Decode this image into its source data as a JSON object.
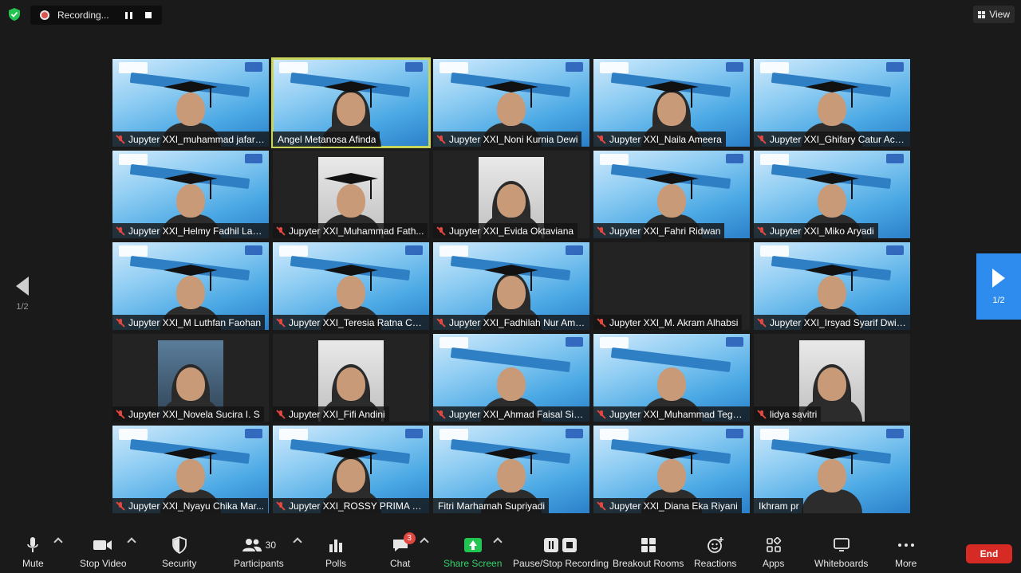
{
  "recording": {
    "label": "Recording..."
  },
  "view_label": "View",
  "pagination": {
    "left": "1/2",
    "right": "1/2"
  },
  "participants": [
    {
      "name": "Jupyter XXI_muhammad jafar ...",
      "muted": true,
      "bg": true,
      "cap": true
    },
    {
      "name": "Angel Metanosa Afinda",
      "muted": false,
      "bg": true,
      "cap": true,
      "active": true,
      "hijab": true
    },
    {
      "name": "Jupyter XXI_Noni Kurnia Dewi",
      "muted": true,
      "bg": true,
      "cap": true
    },
    {
      "name": "Jupyter XXI_Naila Ameera",
      "muted": true,
      "bg": true,
      "cap": true,
      "hijab": true
    },
    {
      "name": "Jupyter XXI_Ghifary Catur Ach...",
      "muted": true,
      "bg": true,
      "cap": true
    },
    {
      "name": "Jupyter XXI_Helmy Fadhil Lan...",
      "muted": true,
      "bg": true,
      "cap": true
    },
    {
      "name": "Jupyter XXI_Muhammad Fath...",
      "muted": true,
      "bg": false,
      "cap": true,
      "cam": "light"
    },
    {
      "name": "Jupyter XXI_Evida Oktaviana",
      "muted": true,
      "bg": false,
      "cap": false,
      "cam": "light",
      "hijab": true
    },
    {
      "name": "Jupyter XXI_Fahri Ridwan",
      "muted": true,
      "bg": true,
      "cap": true
    },
    {
      "name": "Jupyter XXI_Miko Aryadi",
      "muted": true,
      "bg": true,
      "cap": true
    },
    {
      "name": "Jupyter XXI_M Luthfan Faohan",
      "muted": true,
      "bg": true,
      "cap": true
    },
    {
      "name": "Jupyter XXI_Teresia Ratna Cali...",
      "muted": true,
      "bg": true,
      "cap": true
    },
    {
      "name": "Jupyter XXI_Fadhilah Nur Ama...",
      "muted": true,
      "bg": true,
      "cap": true,
      "hijab": true
    },
    {
      "name": "Jupyter XXI_M. Akram Alhabsi",
      "muted": true,
      "bg": false,
      "cap": false,
      "empty": true
    },
    {
      "name": "Jupyter XXI_Irsyad Syarif Dwi ...",
      "muted": true,
      "bg": true,
      "cap": true
    },
    {
      "name": "Jupyter XXI_Novela Sucira I. S",
      "muted": true,
      "bg": false,
      "cap": false,
      "cam": "dark",
      "hijab": true
    },
    {
      "name": "Jupyter XXI_Fifi Andini",
      "muted": true,
      "bg": false,
      "cap": false,
      "cam": "light",
      "hijab": true
    },
    {
      "name": "Jupyter XXI_Ahmad Faisal Sire...",
      "muted": true,
      "bg": true,
      "cap": false
    },
    {
      "name": "Jupyter XXI_Muhammad Tega...",
      "muted": true,
      "bg": true,
      "cap": false
    },
    {
      "name": "lidya savitri",
      "muted": true,
      "bg": false,
      "cap": false,
      "cam": "light",
      "hijab": true
    },
    {
      "name": "Jupyter XXI_Nyayu Chika Mar...",
      "muted": true,
      "bg": true,
      "cap": true
    },
    {
      "name": "Jupyter XXI_ROSSY PRIMA NA...",
      "muted": true,
      "bg": true,
      "cap": true,
      "hijab": true
    },
    {
      "name": "Fitri Marhamah Supriyadi",
      "muted": false,
      "bg": true,
      "cap": true
    },
    {
      "name": "Jupyter XXI_Diana Eka Riyani",
      "muted": true,
      "bg": true,
      "cap": true
    },
    {
      "name": "Ikhram pr",
      "muted": false,
      "bg": true,
      "cap": true
    }
  ],
  "toolbar": {
    "mute": "Mute",
    "stop_video": "Stop Video",
    "security": "Security",
    "participants": "Participants",
    "participants_count": "30",
    "polls": "Polls",
    "chat": "Chat",
    "chat_badge": "3",
    "share_screen": "Share Screen",
    "pause_stop": "Pause/Stop Recording",
    "breakout": "Breakout Rooms",
    "reactions": "Reactions",
    "apps": "Apps",
    "whiteboards": "Whiteboards",
    "more": "More",
    "end": "End"
  },
  "colors": {
    "active_speaker": "#c9d45c",
    "share_green": "#23c552",
    "end_red": "#d62a24",
    "next_page_blue": "#2d8ced"
  }
}
